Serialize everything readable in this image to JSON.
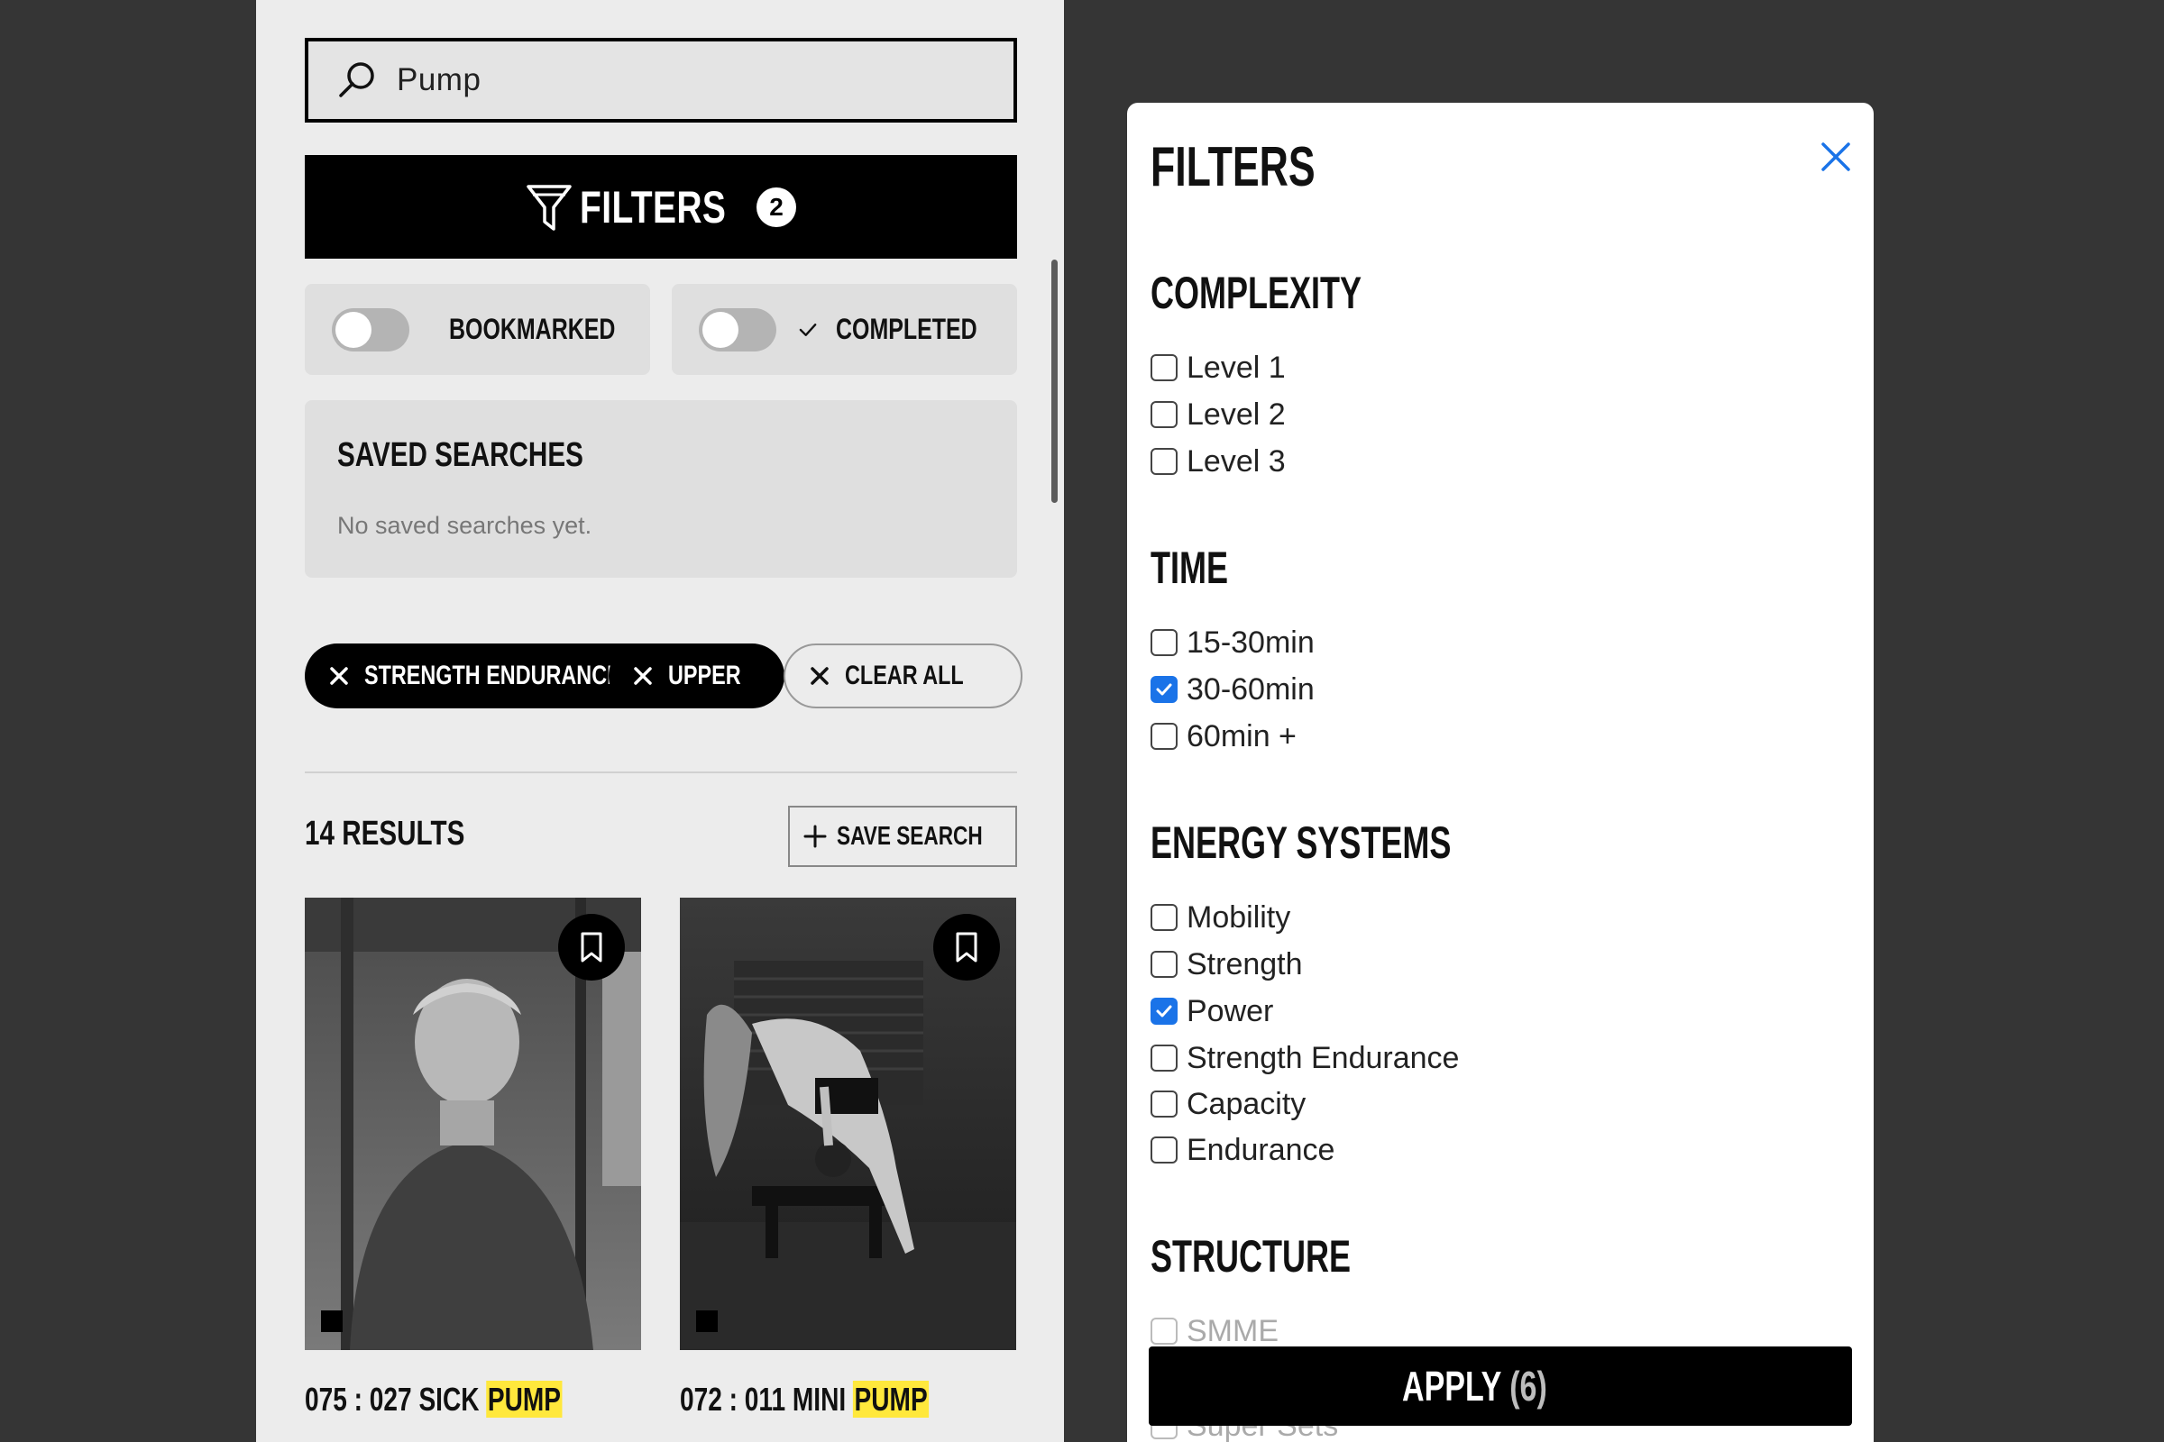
{
  "search": {
    "value": "Pump",
    "icon": "search-icon"
  },
  "filters_button": {
    "label": "FILTERS",
    "count": "2",
    "icon": "funnel-icon"
  },
  "toggles": [
    {
      "label": "BOOKMARKED",
      "icon": "bookmark-icon",
      "on": false
    },
    {
      "label": "COMPLETED",
      "icon": "checkmark-icon",
      "on": false
    }
  ],
  "saved_searches": {
    "title": "SAVED SEARCHES",
    "empty_text": "No saved searches yet."
  },
  "active_filters": [
    {
      "label": "STRENGTH ENDURANCE",
      "icon": "close-icon"
    },
    {
      "label": "UPPER",
      "icon": "close-icon"
    }
  ],
  "clear_all": {
    "label": "CLEAR ALL",
    "icon": "close-icon"
  },
  "results": {
    "count_label": "14 RESULTS",
    "save_search_label": "SAVE SEARCH"
  },
  "cards": [
    {
      "title_prefix": "075 : 027 SICK ",
      "title_highlight": "PUMP",
      "image": "man-in-gym-photo",
      "bookmark_icon": "bookmark-icon"
    },
    {
      "title_prefix": "072 : 011 MINI ",
      "title_highlight": "PUMP",
      "image": "woman-kettlebell-row-photo",
      "bookmark_icon": "bookmark-icon"
    }
  ],
  "modal": {
    "title": "FILTERS",
    "close_icon": "close-icon",
    "sections": {
      "complexity": {
        "title": "COMPLEXITY",
        "options": [
          {
            "label": "Level 1",
            "checked": false
          },
          {
            "label": "Level 2",
            "checked": false
          },
          {
            "label": "Level 3",
            "checked": false
          }
        ]
      },
      "time": {
        "title": "TIME",
        "options": [
          {
            "label": "15-30min",
            "checked": false
          },
          {
            "label": "30-60min",
            "checked": true
          },
          {
            "label": "60min +",
            "checked": false
          }
        ]
      },
      "energy_systems": {
        "title": "ENERGY SYSTEMS",
        "options": [
          {
            "label": "Mobility",
            "checked": false
          },
          {
            "label": "Strength",
            "checked": false
          },
          {
            "label": "Power",
            "checked": true
          },
          {
            "label": "Strength Endurance",
            "checked": false
          },
          {
            "label": "Capacity",
            "checked": false
          },
          {
            "label": "Endurance",
            "checked": false
          }
        ]
      },
      "structure": {
        "title": "STRUCTURE",
        "options": [
          {
            "label": "SMME",
            "checked": false
          },
          {
            "label": "Super Sets",
            "checked": false
          }
        ]
      }
    },
    "apply": {
      "label": "APPLY",
      "count": "(6)"
    }
  },
  "colors": {
    "backdrop": "#353535",
    "panel": "#ececec",
    "accent_blue": "#1a73e8",
    "highlight_yellow": "#ffe83c",
    "black": "#000000"
  }
}
